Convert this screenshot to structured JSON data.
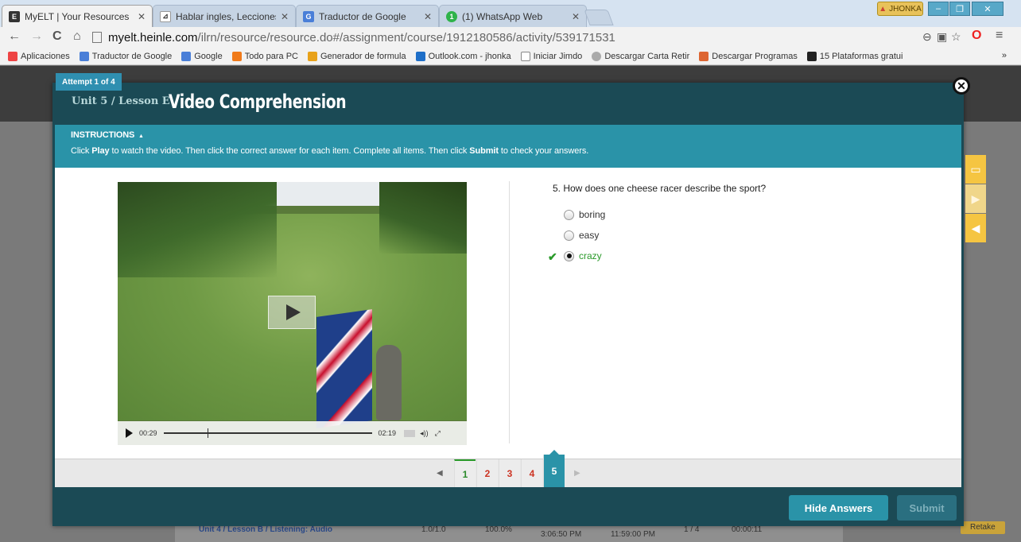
{
  "browser": {
    "tabs": [
      {
        "title": "MyELT | Your Resources",
        "favicon": "E",
        "active": true
      },
      {
        "title": "Hablar ingles, Lecciones de",
        "favicon": "⊿",
        "active": false
      },
      {
        "title": "Traductor de Google",
        "favicon": "G",
        "active": false
      },
      {
        "title": "(1) WhatsApp Web",
        "favicon": "1",
        "active": false
      }
    ],
    "close_glyph": "✕",
    "profile_name": "JHONKA",
    "address": {
      "host": "myelt.heinle.com",
      "path": "/ilrn/resource/resource.do#/assignment/course/1912180586/activity/539171531"
    },
    "bookmarks": [
      {
        "label": "Aplicaciones",
        "color": "#e44"
      },
      {
        "label": "Traductor de Google",
        "color": "#4a7fd8"
      },
      {
        "label": "Google",
        "color": "#4a7fd8"
      },
      {
        "label": "Todo para PC",
        "color": "#f07a1a"
      },
      {
        "label": "Generador de formula",
        "color": "#e8a21a"
      },
      {
        "label": "Outlook.com - jhonka",
        "color": "#1f6fc8"
      },
      {
        "label": "Iniciar Jimdo",
        "color": "#888"
      },
      {
        "label": "Descargar Carta Retir",
        "color": "#aaa"
      },
      {
        "label": "Descargar Programas",
        "color": "#d63"
      },
      {
        "label": "15 Plataformas gratui",
        "color": "#222"
      }
    ],
    "bookmarks_more": "»"
  },
  "background_page": {
    "cells": [
      "Unit 4 / Lesson B / Listening: Audio",
      "1.0/1.0",
      "100.0%",
      "3:06:50 PM",
      "11:59:00 PM",
      "1 / 4",
      "00:00:11",
      "Retake"
    ]
  },
  "modal": {
    "attempt": "Attempt 1 of 4",
    "unit": "Unit 5 / Lesson E",
    "title": "Video Comprehension",
    "instructions_head": "INSTRUCTIONS",
    "instructions": {
      "p1": "Click ",
      "b1": "Play",
      "p2": " to watch the video. Then click the correct answer for each item. Complete all items. Then click ",
      "b2": "Submit",
      "p3": " to check your answers."
    },
    "video": {
      "current_time": "00:29",
      "duration": "02:19"
    },
    "question": "5. How does one cheese racer describe the sport?",
    "options": [
      {
        "label": "boring",
        "selected": false
      },
      {
        "label": "easy",
        "selected": false
      },
      {
        "label": "crazy",
        "selected": true,
        "correct": true
      }
    ],
    "pages": [
      {
        "label": "1",
        "state": "done"
      },
      {
        "label": "2",
        "state": "todo"
      },
      {
        "label": "3",
        "state": "todo"
      },
      {
        "label": "4",
        "state": "todo"
      },
      {
        "label": "5",
        "state": "current"
      }
    ],
    "hide_answers": "Hide Answers",
    "submit": "Submit"
  }
}
